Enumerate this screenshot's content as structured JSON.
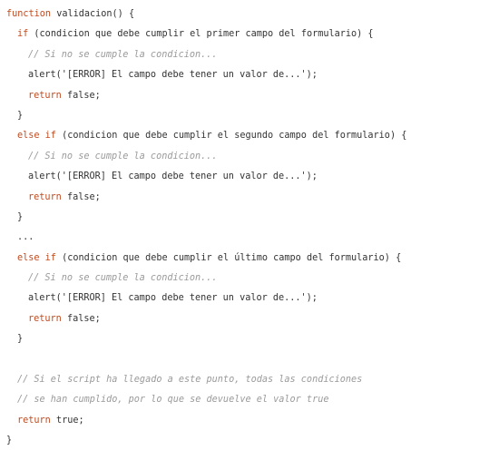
{
  "code": {
    "lines": [
      {
        "indent": 0,
        "tokens": [
          {
            "t": "kw",
            "v": "function"
          },
          {
            "t": "pl",
            "v": " validacion() {"
          }
        ]
      },
      {
        "indent": 1,
        "tokens": [
          {
            "t": "kw",
            "v": "if"
          },
          {
            "t": "pl",
            "v": " (condicion que debe cumplir el primer campo del formulario) {"
          }
        ]
      },
      {
        "indent": 2,
        "tokens": [
          {
            "t": "cm",
            "v": "// Si no se cumple la condicion..."
          }
        ]
      },
      {
        "indent": 2,
        "tokens": [
          {
            "t": "pl",
            "v": "alert('[ERROR] El campo debe tener un valor de...');"
          }
        ]
      },
      {
        "indent": 2,
        "tokens": [
          {
            "t": "kw",
            "v": "return"
          },
          {
            "t": "pl",
            "v": " false;"
          }
        ]
      },
      {
        "indent": 1,
        "tokens": [
          {
            "t": "pl",
            "v": "}"
          }
        ]
      },
      {
        "indent": 1,
        "tokens": [
          {
            "t": "kw",
            "v": "else if"
          },
          {
            "t": "pl",
            "v": " (condicion que debe cumplir el segundo campo del formulario) {"
          }
        ]
      },
      {
        "indent": 2,
        "tokens": [
          {
            "t": "cm",
            "v": "// Si no se cumple la condicion..."
          }
        ]
      },
      {
        "indent": 2,
        "tokens": [
          {
            "t": "pl",
            "v": "alert('[ERROR] El campo debe tener un valor de...');"
          }
        ]
      },
      {
        "indent": 2,
        "tokens": [
          {
            "t": "kw",
            "v": "return"
          },
          {
            "t": "pl",
            "v": " false;"
          }
        ]
      },
      {
        "indent": 1,
        "tokens": [
          {
            "t": "pl",
            "v": "}"
          }
        ]
      },
      {
        "indent": 1,
        "tokens": [
          {
            "t": "pl",
            "v": "..."
          }
        ]
      },
      {
        "indent": 1,
        "tokens": [
          {
            "t": "kw",
            "v": "else if"
          },
          {
            "t": "pl",
            "v": " (condicion que debe cumplir el último campo del formulario) {"
          }
        ]
      },
      {
        "indent": 2,
        "tokens": [
          {
            "t": "cm",
            "v": "// Si no se cumple la condicion..."
          }
        ]
      },
      {
        "indent": 2,
        "tokens": [
          {
            "t": "pl",
            "v": "alert('[ERROR] El campo debe tener un valor de...');"
          }
        ]
      },
      {
        "indent": 2,
        "tokens": [
          {
            "t": "kw",
            "v": "return"
          },
          {
            "t": "pl",
            "v": " false;"
          }
        ]
      },
      {
        "indent": 1,
        "tokens": [
          {
            "t": "pl",
            "v": "}"
          }
        ]
      },
      {
        "indent": 1,
        "tokens": []
      },
      {
        "indent": 1,
        "tokens": [
          {
            "t": "cm",
            "v": "// Si el script ha llegado a este punto, todas las condiciones"
          }
        ]
      },
      {
        "indent": 1,
        "tokens": [
          {
            "t": "cm",
            "v": "// se han cumplido, por lo que se devuelve el valor true"
          }
        ]
      },
      {
        "indent": 1,
        "tokens": [
          {
            "t": "kw",
            "v": "return"
          },
          {
            "t": "pl",
            "v": " true;"
          }
        ]
      },
      {
        "indent": 0,
        "tokens": [
          {
            "t": "pl",
            "v": "}"
          }
        ]
      }
    ]
  },
  "colors": {
    "keyword": "#c24b1f",
    "comment": "#9a9a9a",
    "plain": "#333333",
    "background": "#ffffff"
  }
}
